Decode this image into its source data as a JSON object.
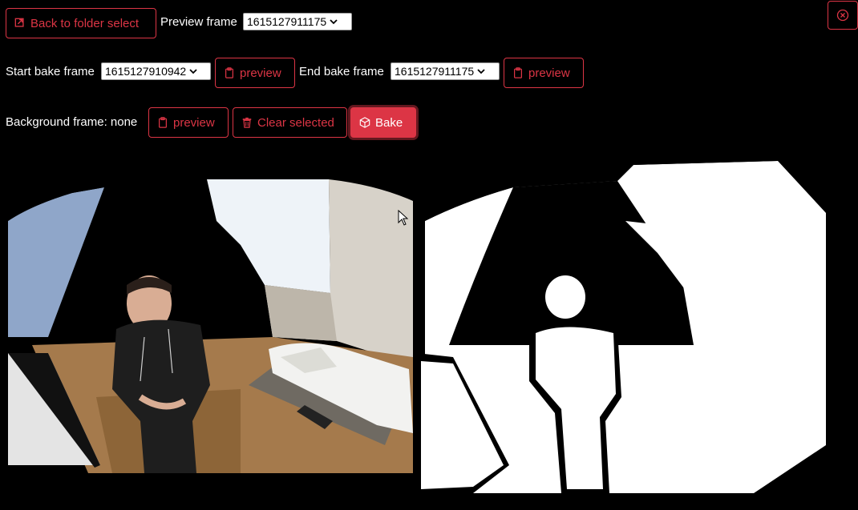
{
  "toolbar": {
    "back_label": "Back to folder select",
    "preview_frame_label": "Preview frame",
    "preview_frame_value": "1615127911175",
    "start_bake_label": "Start bake frame",
    "start_bake_value": "1615127910942",
    "start_preview_label": "preview",
    "end_bake_label": "End bake frame",
    "end_bake_value": "1615127911175",
    "end_preview_label": "preview",
    "background_label": "Background frame: none",
    "background_preview_label": "preview",
    "clear_label": "Clear selected",
    "bake_label": "Bake"
  },
  "colors": {
    "accent": "#dc3545",
    "background": "#000000"
  },
  "icons": [
    "box-arrow-icon",
    "clipboard-icon",
    "trash-icon",
    "box-icon",
    "close-circle-icon",
    "chevron-down-icon",
    "mouse-cursor-icon"
  ]
}
